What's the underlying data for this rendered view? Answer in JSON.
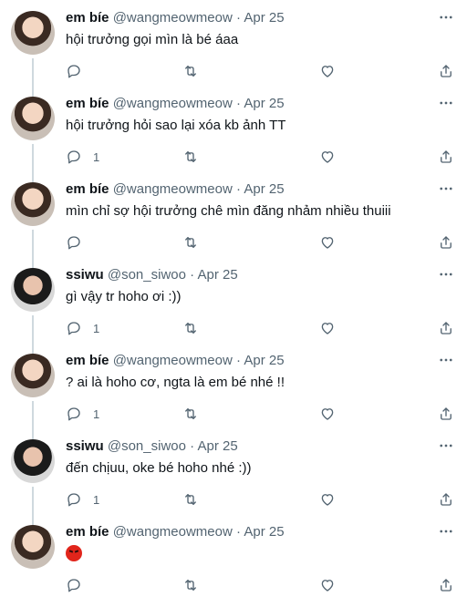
{
  "tweets": [
    {
      "name": "em bíe",
      "handle": "@wangmeowmeow",
      "dot": "·",
      "date": "Apr 25",
      "text": "hội trưởng gọi mìn là bé áaa",
      "reply_count": "",
      "avatar": "emb"
    },
    {
      "name": "em bíe",
      "handle": "@wangmeowmeow",
      "dot": "·",
      "date": "Apr 25",
      "text": "hội trưởng hỏi sao lại xóa kb ảnh TT",
      "reply_count": "1",
      "avatar": "emb"
    },
    {
      "name": "em bíe",
      "handle": "@wangmeowmeow",
      "dot": "·",
      "date": "Apr 25",
      "text": "mìn chỉ sợ hội trưởng chê mìn đăng nhảm nhiều thuiii",
      "reply_count": "",
      "avatar": "emb"
    },
    {
      "name": "ssiwu",
      "handle": "@son_siwoo",
      "dot": "·",
      "date": "Apr 25",
      "text": "gì vậy tr hoho ơi :))",
      "reply_count": "1",
      "avatar": "ssi"
    },
    {
      "name": "em bíe",
      "handle": "@wangmeowmeow",
      "dot": "·",
      "date": "Apr 25",
      "text": "? ai là hoho cơ, ngta là em bé nhé !!",
      "reply_count": "1",
      "avatar": "emb"
    },
    {
      "name": "ssiwu",
      "handle": "@son_siwoo",
      "dot": "·",
      "date": "Apr 25",
      "text": "đến chịuu, oke bé hoho nhé :))",
      "reply_count": "1",
      "avatar": "ssi"
    },
    {
      "name": "em bíe",
      "handle": "@wangmeowmeow",
      "dot": "·",
      "date": "Apr 25",
      "text": "",
      "emoji": "angry-face",
      "reply_count": "",
      "avatar": "emb"
    }
  ],
  "icons": {
    "reply": "reply-icon",
    "retweet": "retweet-icon",
    "like": "like-icon",
    "share": "share-icon",
    "more": "more-icon"
  }
}
